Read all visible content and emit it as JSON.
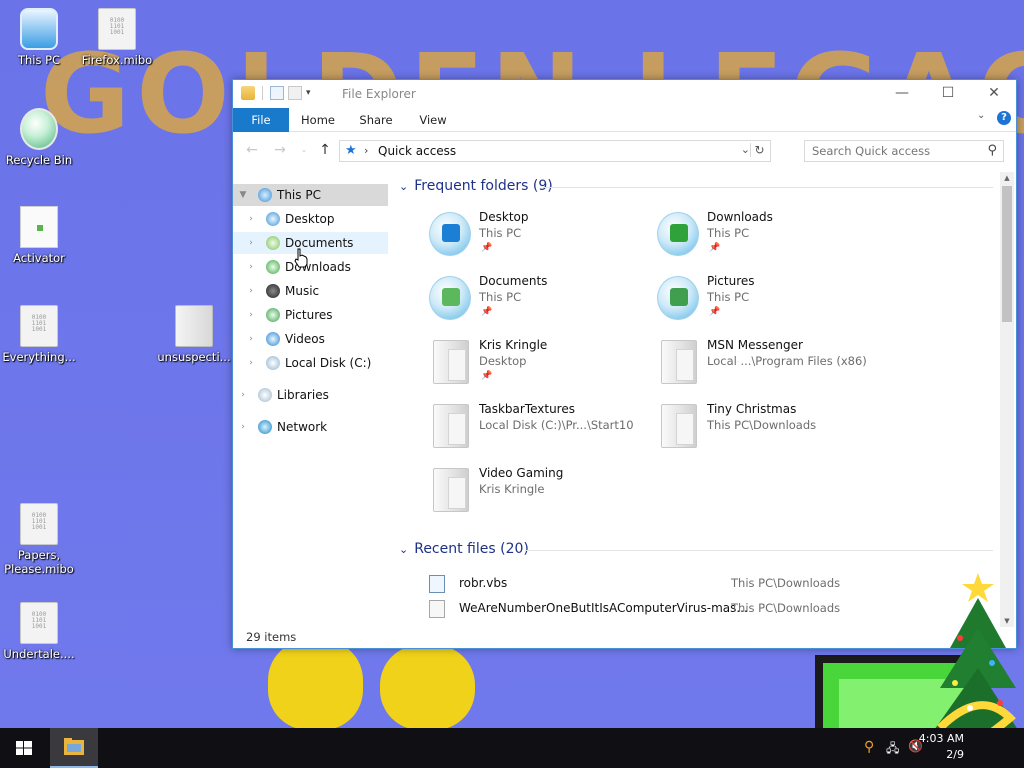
{
  "desktop": {
    "wallpaper_text": "GOLDEN LEGACY",
    "icons": [
      {
        "label": "This PC"
      },
      {
        "label": "Firefox.mibo"
      },
      {
        "label": "Recycle Bin"
      },
      {
        "label": "Activator"
      },
      {
        "label": "Everything..."
      },
      {
        "label": "unsuspecti..."
      },
      {
        "label": "Papers, Please.mibo"
      },
      {
        "label": "Undertale...."
      }
    ],
    "binary_text": "0100\n1101\n1001"
  },
  "explorer": {
    "title": "File Explorer",
    "controls": {
      "minimize": "—",
      "maximize": "☐",
      "close": "✕"
    },
    "ribbon_tabs": [
      "File",
      "Home",
      "Share",
      "View"
    ],
    "address": {
      "path": "Quick access"
    },
    "search": {
      "placeholder": "Search Quick access"
    },
    "nav": {
      "this_pc": "This PC",
      "items": [
        "Desktop",
        "Documents",
        "Downloads",
        "Music",
        "Pictures",
        "Videos",
        "Local Disk (C:)"
      ],
      "libraries": "Libraries",
      "network": "Network"
    },
    "frequent": {
      "header": "Frequent folders (9)",
      "folders": [
        {
          "name": "Desktop",
          "location": "This PC",
          "pinned": true,
          "icon": "desktop-folder-icon",
          "color": "#1b7fd6"
        },
        {
          "name": "Downloads",
          "location": "This PC",
          "pinned": true,
          "icon": "downloads-folder-icon",
          "color": "#2fa33a"
        },
        {
          "name": "Documents",
          "location": "This PC",
          "pinned": true,
          "icon": "documents-folder-icon",
          "color": "#5cb85c"
        },
        {
          "name": "Pictures",
          "location": "This PC",
          "pinned": true,
          "icon": "pictures-folder-icon",
          "color": "#3f9f4f"
        },
        {
          "name": "Kris Kringle",
          "location": "Desktop",
          "pinned": true,
          "icon": "folder-icon"
        },
        {
          "name": "MSN Messenger",
          "location": "Local ...\\Program Files (x86)",
          "pinned": false,
          "icon": "folder-icon"
        },
        {
          "name": "TaskbarTextures",
          "location": "Local Disk (C:)\\Pr...\\Start10",
          "pinned": false,
          "icon": "folder-icon"
        },
        {
          "name": "Tiny Christmas",
          "location": "This PC\\Downloads",
          "pinned": false,
          "icon": "folder-icon"
        },
        {
          "name": "Video Gaming",
          "location": "Kris Kringle",
          "pinned": false,
          "icon": "folder-icon"
        }
      ]
    },
    "recent": {
      "header": "Recent files (20)",
      "files": [
        {
          "name": "robr.vbs",
          "path": "This PC\\Downloads"
        },
        {
          "name": "WeAreNumberOneButItIsAComputerVirus-mas...",
          "path": "This PC\\Downloads"
        }
      ]
    },
    "status": "29 items"
  },
  "taskbar": {
    "clock_time": "4:03 AM",
    "clock_date": "2/9"
  }
}
